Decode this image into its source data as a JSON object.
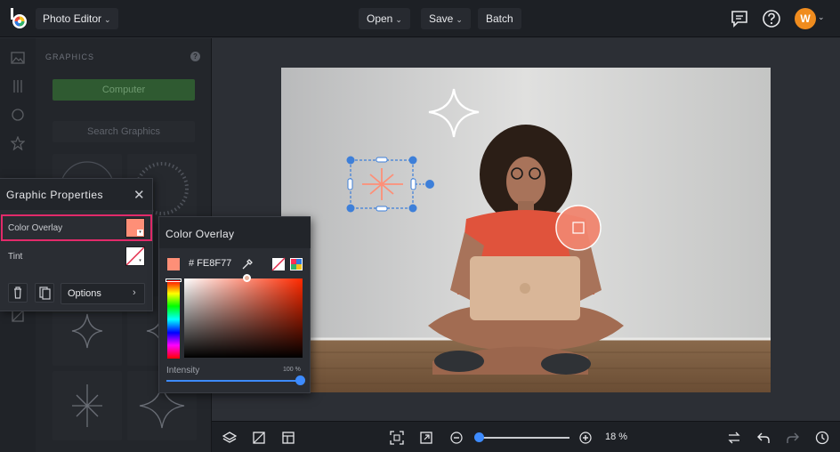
{
  "app": {
    "menu_label": "Photo Editor",
    "avatar_initial": "W"
  },
  "toolbar": {
    "open_label": "Open",
    "save_label": "Save",
    "batch_label": "Batch"
  },
  "side_panel": {
    "section_title": "GRAPHICS",
    "computer_label": "Computer",
    "search_label": "Search Graphics"
  },
  "graphic_properties": {
    "title": "Graphic Properties",
    "color_overlay_label": "Color Overlay",
    "tint_label": "Tint",
    "options_label": "Options",
    "overlay_swatch_color": "#FE8F77"
  },
  "color_overlay": {
    "title": "Color Overlay",
    "hex_value": "# FE8F77",
    "current_color": "#FE8F77",
    "intensity_label": "Intensity",
    "intensity_value": "100 %",
    "intensity_fraction": 1.0
  },
  "zoom": {
    "value": "18 %",
    "fraction": 0.0
  },
  "colors": {
    "accent": "#3d8bff",
    "highlight": "#e22a6a",
    "avatar": "#f08c1e"
  }
}
